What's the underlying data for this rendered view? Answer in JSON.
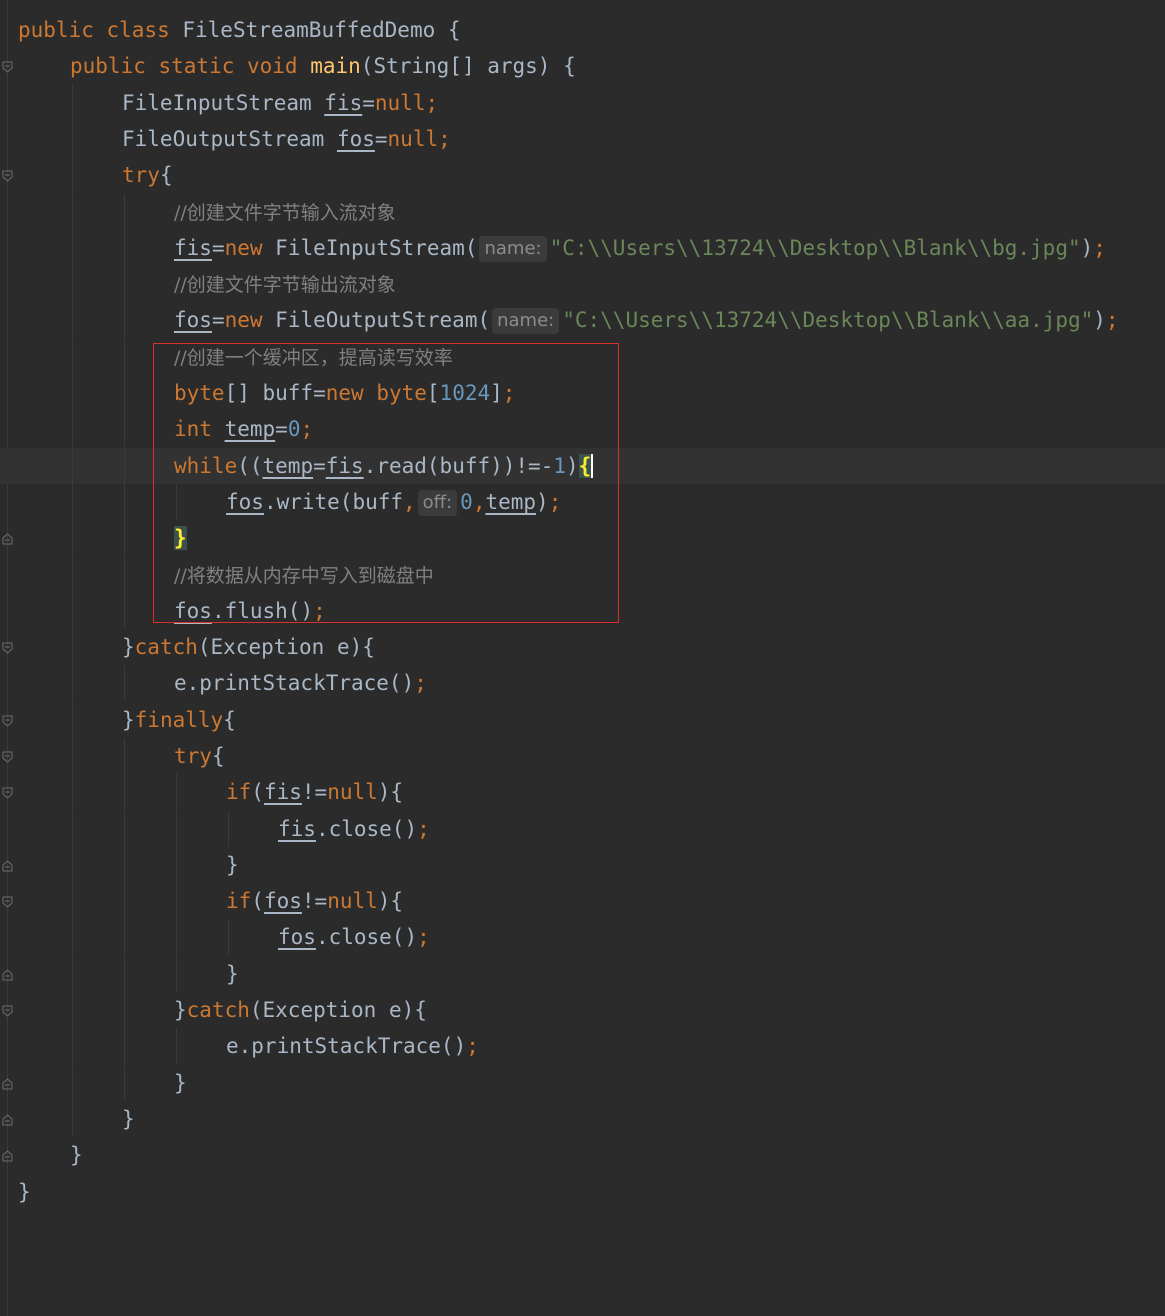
{
  "editor": {
    "lines": [
      {
        "indent": 0,
        "tokens": [
          {
            "t": "public class ",
            "c": "kw"
          },
          {
            "t": "FileStreamBuffedDemo {",
            "c": "plain"
          }
        ]
      },
      {
        "indent": 1,
        "fold": true,
        "tokens": [
          {
            "t": "public static void ",
            "c": "kw"
          },
          {
            "t": "main",
            "c": "fn"
          },
          {
            "t": "(String[] args) {",
            "c": "plain"
          }
        ]
      },
      {
        "indent": 2,
        "tokens": [
          {
            "t": "FileInputStream ",
            "c": "plain"
          },
          {
            "t": "fis",
            "c": "var"
          },
          {
            "t": "=",
            "c": "plain"
          },
          {
            "t": "null",
            "c": "kw"
          },
          {
            "t": ";",
            "c": "punct"
          }
        ]
      },
      {
        "indent": 2,
        "tokens": [
          {
            "t": "FileOutputStream ",
            "c": "plain"
          },
          {
            "t": "fos",
            "c": "var"
          },
          {
            "t": "=",
            "c": "plain"
          },
          {
            "t": "null",
            "c": "kw"
          },
          {
            "t": ";",
            "c": "punct"
          }
        ]
      },
      {
        "indent": 2,
        "fold": true,
        "tokens": [
          {
            "t": "try",
            "c": "kw"
          },
          {
            "t": "{",
            "c": "plain"
          }
        ]
      },
      {
        "indent": 3,
        "tokens": [
          {
            "t": "//创建文件字节输入流对象",
            "c": "cmt"
          }
        ]
      },
      {
        "indent": 3,
        "tokens": [
          {
            "t": "fis",
            "c": "var"
          },
          {
            "t": "=",
            "c": "plain"
          },
          {
            "t": "new ",
            "c": "kw"
          },
          {
            "t": "FileInputStream(",
            "c": "plain"
          },
          {
            "t": "name:",
            "c": "hint"
          },
          {
            "t": "\"C:\\\\Users\\\\13724\\\\Desktop\\\\Blank\\\\bg.jpg\"",
            "c": "str"
          },
          {
            "t": ")",
            "c": "plain"
          },
          {
            "t": ";",
            "c": "punct"
          }
        ]
      },
      {
        "indent": 3,
        "tokens": [
          {
            "t": "//创建文件字节输出流对象",
            "c": "cmt"
          }
        ]
      },
      {
        "indent": 3,
        "tokens": [
          {
            "t": "fos",
            "c": "var"
          },
          {
            "t": "=",
            "c": "plain"
          },
          {
            "t": "new ",
            "c": "kw"
          },
          {
            "t": "FileOutputStream(",
            "c": "plain"
          },
          {
            "t": "name:",
            "c": "hint"
          },
          {
            "t": "\"C:\\\\Users\\\\13724\\\\Desktop\\\\Blank\\\\aa.jpg\"",
            "c": "str"
          },
          {
            "t": ")",
            "c": "plain"
          },
          {
            "t": ";",
            "c": "punct"
          }
        ]
      },
      {
        "indent": 3,
        "tokens": [
          {
            "t": "//创建一个缓冲区，提高读写效率",
            "c": "cmt"
          }
        ]
      },
      {
        "indent": 3,
        "tokens": [
          {
            "t": "byte",
            "c": "kw"
          },
          {
            "t": "[] buff=",
            "c": "plain"
          },
          {
            "t": "new ",
            "c": "kw"
          },
          {
            "t": "byte",
            "c": "kw"
          },
          {
            "t": "[",
            "c": "plain"
          },
          {
            "t": "1024",
            "c": "num"
          },
          {
            "t": "]",
            "c": "plain"
          },
          {
            "t": ";",
            "c": "punct"
          }
        ]
      },
      {
        "indent": 3,
        "tokens": [
          {
            "t": "int ",
            "c": "kw"
          },
          {
            "t": "temp",
            "c": "var"
          },
          {
            "t": "=",
            "c": "plain"
          },
          {
            "t": "0",
            "c": "num"
          },
          {
            "t": ";",
            "c": "punct"
          }
        ]
      },
      {
        "indent": 3,
        "fold": true,
        "current": true,
        "tokens": [
          {
            "t": "while",
            "c": "kw"
          },
          {
            "t": "((",
            "c": "plain"
          },
          {
            "t": "temp",
            "c": "var"
          },
          {
            "t": "=",
            "c": "plain"
          },
          {
            "t": "fis",
            "c": "var"
          },
          {
            "t": ".read(buff))!=-",
            "c": "plain"
          },
          {
            "t": "1",
            "c": "num"
          },
          {
            "t": ")",
            "c": "plain"
          },
          {
            "t": "{",
            "c": "brace"
          },
          {
            "t": "",
            "c": "caret"
          }
        ]
      },
      {
        "indent": 4,
        "tokens": [
          {
            "t": "fos",
            "c": "var"
          },
          {
            "t": ".write(buff",
            "c": "plain"
          },
          {
            "t": ",",
            "c": "punct"
          },
          {
            "t": "off:",
            "c": "hint"
          },
          {
            "t": "0",
            "c": "num"
          },
          {
            "t": ",",
            "c": "punct"
          },
          {
            "t": "temp",
            "c": "var"
          },
          {
            "t": ")",
            "c": "plain"
          },
          {
            "t": ";",
            "c": "punct"
          }
        ]
      },
      {
        "indent": 3,
        "foldEnd": true,
        "tokens": [
          {
            "t": "}",
            "c": "brace"
          }
        ]
      },
      {
        "indent": 3,
        "tokens": [
          {
            "t": "//将数据从内存中写入到磁盘中",
            "c": "cmt"
          }
        ]
      },
      {
        "indent": 3,
        "tokens": [
          {
            "t": "fos",
            "c": "var"
          },
          {
            "t": ".flush()",
            "c": "plain"
          },
          {
            "t": ";",
            "c": "punct"
          }
        ]
      },
      {
        "indent": 2,
        "fold": true,
        "tokens": [
          {
            "t": "}",
            "c": "plain"
          },
          {
            "t": "catch",
            "c": "kw"
          },
          {
            "t": "(Exception e){",
            "c": "plain"
          }
        ]
      },
      {
        "indent": 3,
        "tokens": [
          {
            "t": "e.printStackTrace()",
            "c": "plain"
          },
          {
            "t": ";",
            "c": "punct"
          }
        ]
      },
      {
        "indent": 2,
        "fold": true,
        "tokens": [
          {
            "t": "}",
            "c": "plain"
          },
          {
            "t": "finally",
            "c": "kw"
          },
          {
            "t": "{",
            "c": "plain"
          }
        ]
      },
      {
        "indent": 3,
        "fold": true,
        "tokens": [
          {
            "t": "try",
            "c": "kw"
          },
          {
            "t": "{",
            "c": "plain"
          }
        ]
      },
      {
        "indent": 4,
        "fold": true,
        "tokens": [
          {
            "t": "if",
            "c": "kw"
          },
          {
            "t": "(",
            "c": "plain"
          },
          {
            "t": "fis",
            "c": "var"
          },
          {
            "t": "!=",
            "c": "plain"
          },
          {
            "t": "null",
            "c": "kw"
          },
          {
            "t": "){",
            "c": "plain"
          }
        ]
      },
      {
        "indent": 5,
        "tokens": [
          {
            "t": "fis",
            "c": "var"
          },
          {
            "t": ".close()",
            "c": "plain"
          },
          {
            "t": ";",
            "c": "punct"
          }
        ]
      },
      {
        "indent": 4,
        "foldEnd": true,
        "tokens": [
          {
            "t": "}",
            "c": "plain"
          }
        ]
      },
      {
        "indent": 4,
        "fold": true,
        "tokens": [
          {
            "t": "if",
            "c": "kw"
          },
          {
            "t": "(",
            "c": "plain"
          },
          {
            "t": "fos",
            "c": "var"
          },
          {
            "t": "!=",
            "c": "plain"
          },
          {
            "t": "null",
            "c": "kw"
          },
          {
            "t": "){",
            "c": "plain"
          }
        ]
      },
      {
        "indent": 5,
        "tokens": [
          {
            "t": "fos",
            "c": "var"
          },
          {
            "t": ".close()",
            "c": "plain"
          },
          {
            "t": ";",
            "c": "punct"
          }
        ]
      },
      {
        "indent": 4,
        "foldEnd": true,
        "tokens": [
          {
            "t": "}",
            "c": "plain"
          }
        ]
      },
      {
        "indent": 3,
        "fold": true,
        "tokens": [
          {
            "t": "}",
            "c": "plain"
          },
          {
            "t": "catch",
            "c": "kw"
          },
          {
            "t": "(Exception e){",
            "c": "plain"
          }
        ]
      },
      {
        "indent": 4,
        "tokens": [
          {
            "t": "e.printStackTrace()",
            "c": "plain"
          },
          {
            "t": ";",
            "c": "punct"
          }
        ]
      },
      {
        "indent": 3,
        "foldEnd": true,
        "tokens": [
          {
            "t": "}",
            "c": "plain"
          }
        ]
      },
      {
        "indent": 2,
        "foldEnd": true,
        "tokens": [
          {
            "t": "}",
            "c": "plain"
          }
        ]
      },
      {
        "indent": 1,
        "foldEnd": true,
        "tokens": [
          {
            "t": "}",
            "c": "plain"
          }
        ]
      },
      {
        "indent": 0,
        "tokens": [
          {
            "t": "}",
            "c": "plain"
          }
        ]
      }
    ]
  },
  "colors": {
    "background": "#2b2b2b",
    "keyword": "#cc7832",
    "method": "#ffc66d",
    "string": "#6a8759",
    "number": "#6897bb",
    "comment": "#808080",
    "text": "#a9b7c6",
    "highlight_box": "#d8312c"
  }
}
